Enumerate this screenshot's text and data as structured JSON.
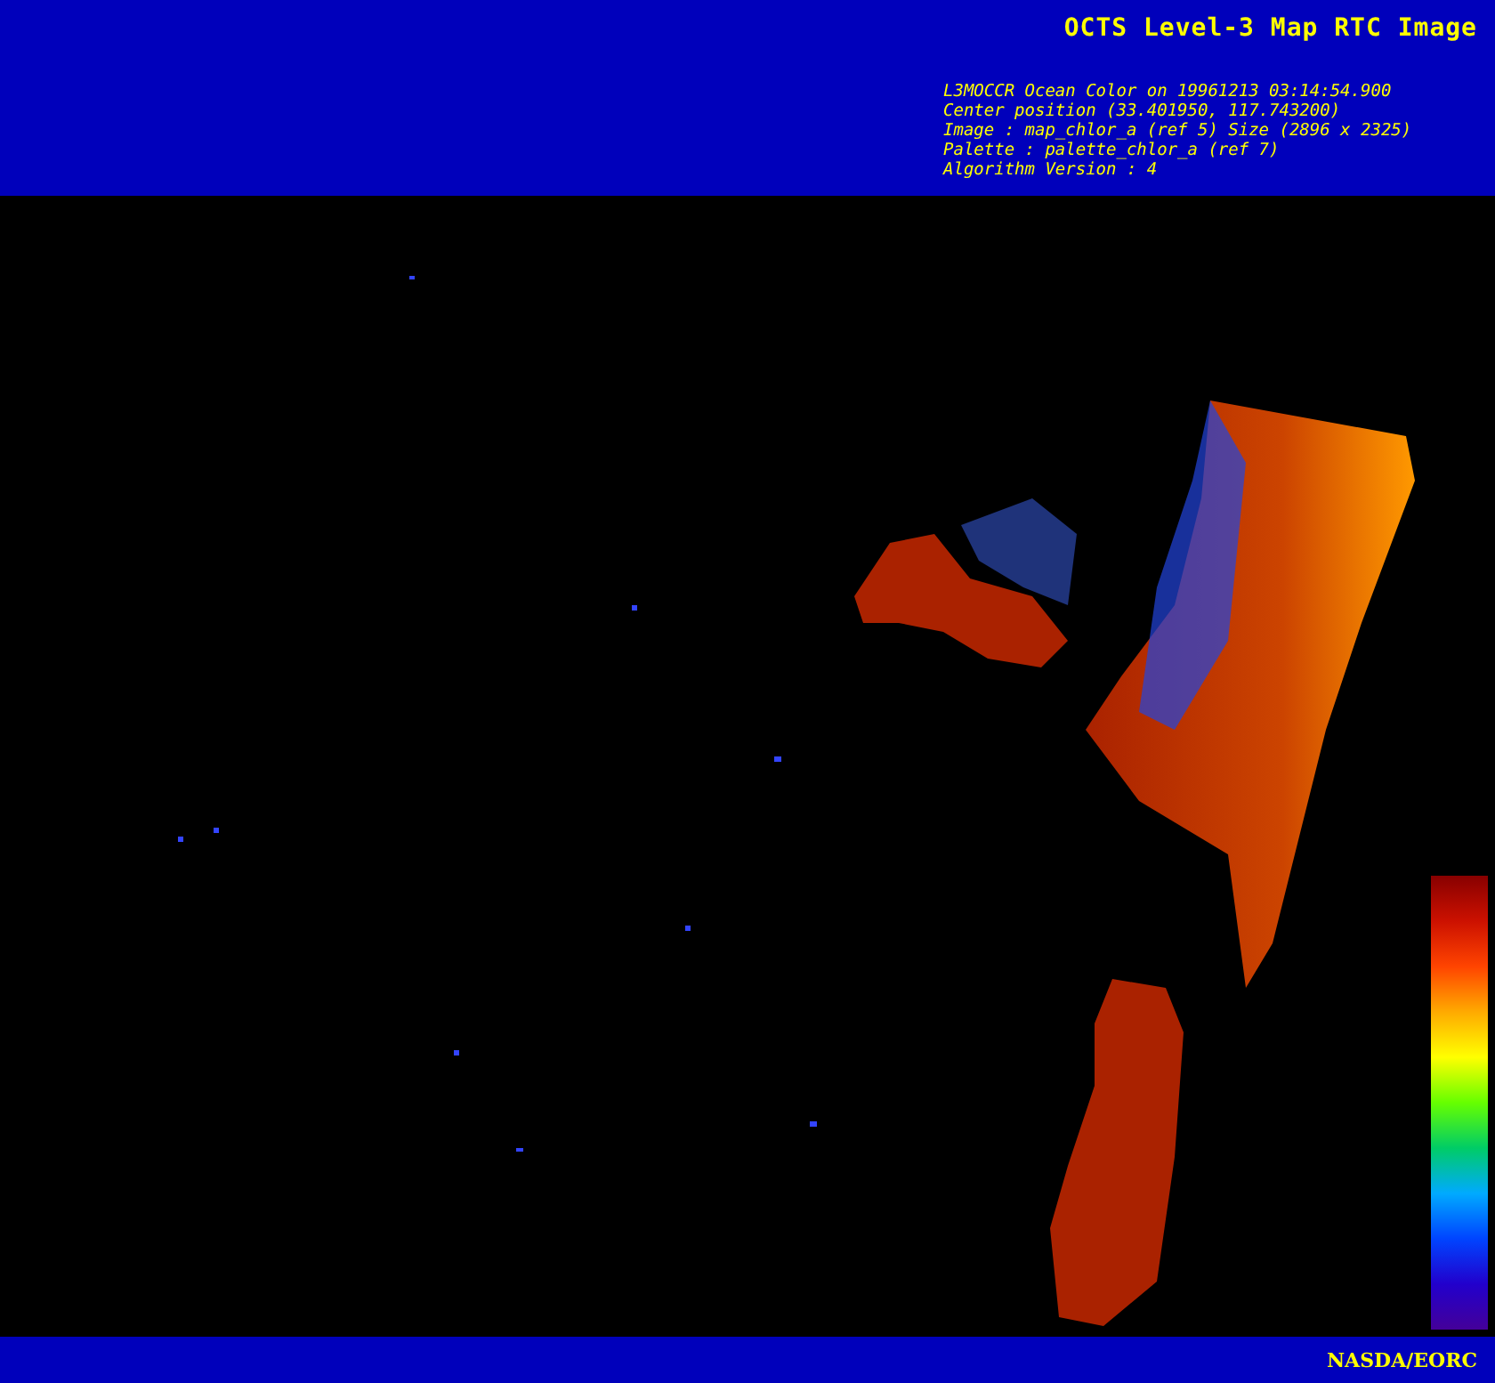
{
  "header": {
    "title": "OCTS Level-3 Map RTC Image",
    "info_lines": [
      "L3MOCCR Ocean Color on 19961213 03:14:54.900",
      "Center position (33.401950, 117.743200)",
      "Image : map_chlor_a (ref 5) Size (2896 x 2325)",
      "Palette : palette_chlor_a (ref 7)",
      "Algorithm Version : 4"
    ]
  },
  "footer": {
    "credit": "NASDA/EORC"
  }
}
